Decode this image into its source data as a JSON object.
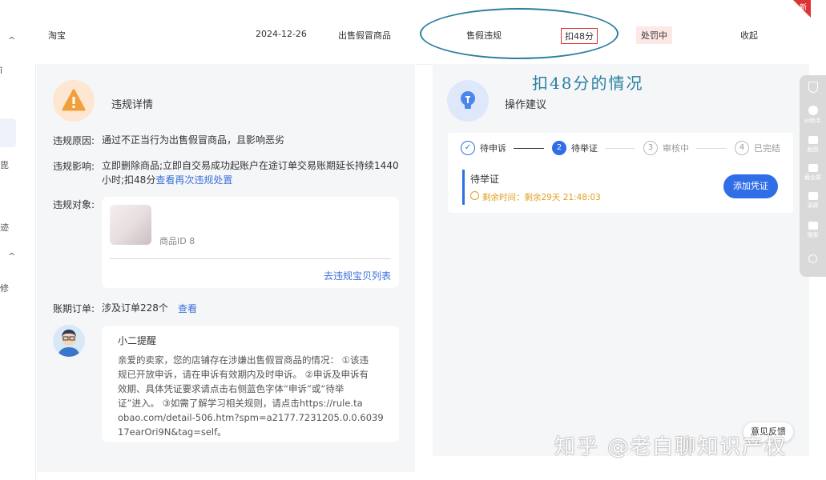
{
  "left_nav": {
    "marks": [
      "^",
      "ǐ",
      "毘",
      "迹",
      "^",
      "修"
    ]
  },
  "top_row": {
    "platform": "淘宝",
    "date": "2024-12-26",
    "type": "出售假冒商品",
    "violation": "售假违规",
    "deduction": "扣48分",
    "status": "处罚中",
    "collapse": "收起",
    "new_tag": "新"
  },
  "annotation": {
    "handwritten": "扣48分的情况"
  },
  "details": {
    "title": "违规详情",
    "reason_label": "违规原因:",
    "reason_value": "通过不正当行为出售假冒商品，且影响恶劣",
    "impact_label": "违规影响:",
    "impact_value_line1": "立即删除商品;立即自交易成功起账户在途订单交易账期延长持续1440",
    "impact_value_line2": "小时;扣48分",
    "impact_link": "查看再次违规处置",
    "object_label": "违规对象:",
    "product_id": "商品ID 8",
    "product_list_link": "去违规宝贝列表",
    "orders_label": "账期订单:",
    "orders_value": "涉及订单228个",
    "orders_link": "查看"
  },
  "reminder": {
    "title": "小二提醒",
    "lines": [
      "亲爱的卖家，您的店铺存在涉嫌出售假冒商品的情况：  ①该违",
      "规已开放申诉，请在申诉有效期内及时申诉。 ②申诉及申诉有",
      "效期、具体凭证要求请点击右侧蓝色字体“申诉”或“待举",
      "证”进入。 ③如需了解学习相关规则，请点击https://rule.ta",
      "obao.com/detail-506.htm?spm=a2177.7231205.0.0.6039",
      "17earOri9N&tag=self。"
    ]
  },
  "advice": {
    "title": "操作建议",
    "steps": [
      {
        "num": "✓",
        "label": "待申诉",
        "state": "done"
      },
      {
        "num": "2",
        "label": "待举证",
        "state": "active"
      },
      {
        "num": "3",
        "label": "审核中",
        "state": "pending"
      },
      {
        "num": "4",
        "label": "已完结",
        "state": "pending"
      }
    ],
    "current_status": "待举证",
    "remaining": "剩余时间：剩余29天 21:48:03",
    "button": "添加凭证"
  },
  "toolbar": {
    "items": [
      "AI助手",
      "截图",
      "截全屏",
      "录屏",
      "搜索"
    ]
  },
  "feedback": "意见反馈",
  "watermark": "知乎 @老白聊知识产权",
  "colors": {
    "accent": "#2f6ee6",
    "danger": "#d33333",
    "warning": "#e0a020",
    "annotation": "#2a7fa0"
  }
}
